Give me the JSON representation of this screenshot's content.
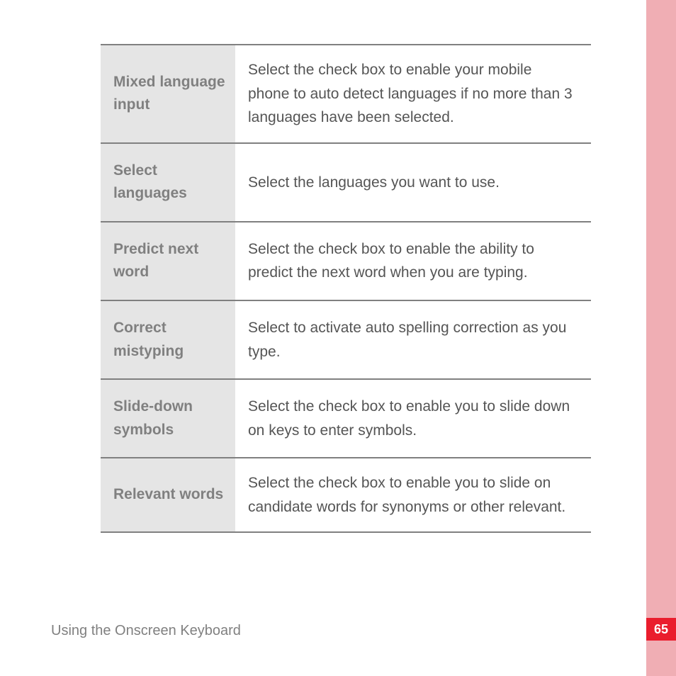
{
  "footer": "Using the Onscreen Keyboard",
  "pageNumber": "65",
  "rows": [
    {
      "label": "Mixed language input",
      "desc": "Select the check box to enable your mobile phone to auto detect languages if no more than 3 languages have been selected."
    },
    {
      "label": "Select languages",
      "desc": "Select the languages you want to use."
    },
    {
      "label": "Predict next word",
      "desc": "Select the check box to enable the ability to predict the next word when you are typing."
    },
    {
      "label": "Correct mistyping",
      "desc": "Select to activate auto spelling correction as you type."
    },
    {
      "label": "Slide-down symbols",
      "desc": "Select the check box to enable you to slide down on keys to enter symbols."
    },
    {
      "label": "Relevant words",
      "desc": "Select the check box to enable you to slide on candidate words for synonyms or other relevant."
    }
  ]
}
